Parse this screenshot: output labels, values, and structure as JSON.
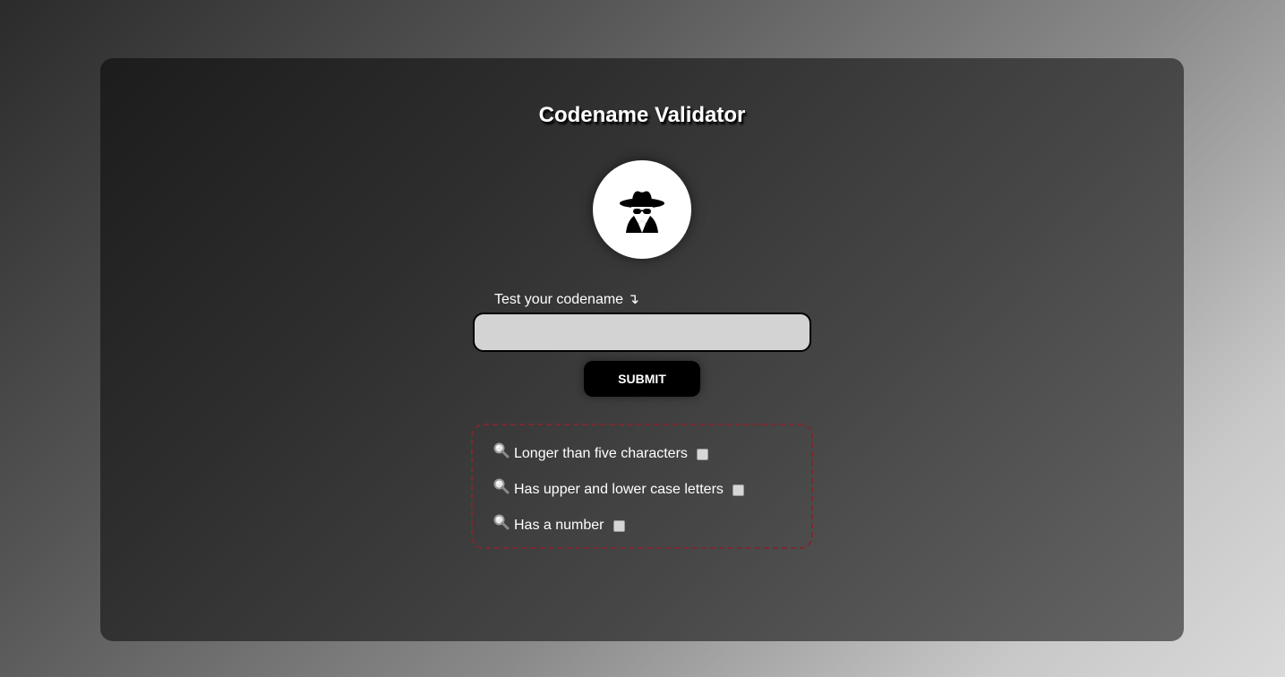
{
  "app": {
    "title": "Codename Validator"
  },
  "avatar": {
    "icon": "spy-icon"
  },
  "form": {
    "label": "Test your codename ↴",
    "input_value": "",
    "input_placeholder": "",
    "submit_label": "SUBMIT"
  },
  "checks": {
    "items": [
      {
        "icon": "magnifier-icon",
        "label": "Longer than five characters",
        "checked": false
      },
      {
        "icon": "magnifier-icon",
        "label": "Has upper and lower case letters",
        "checked": false
      },
      {
        "icon": "magnifier-icon",
        "label": "Has a number",
        "checked": false
      }
    ],
    "border_color": "#7a2a30"
  },
  "colors": {
    "input_bg": "#d3d3d3",
    "button_bg": "#000000",
    "text": "#ffffff"
  }
}
